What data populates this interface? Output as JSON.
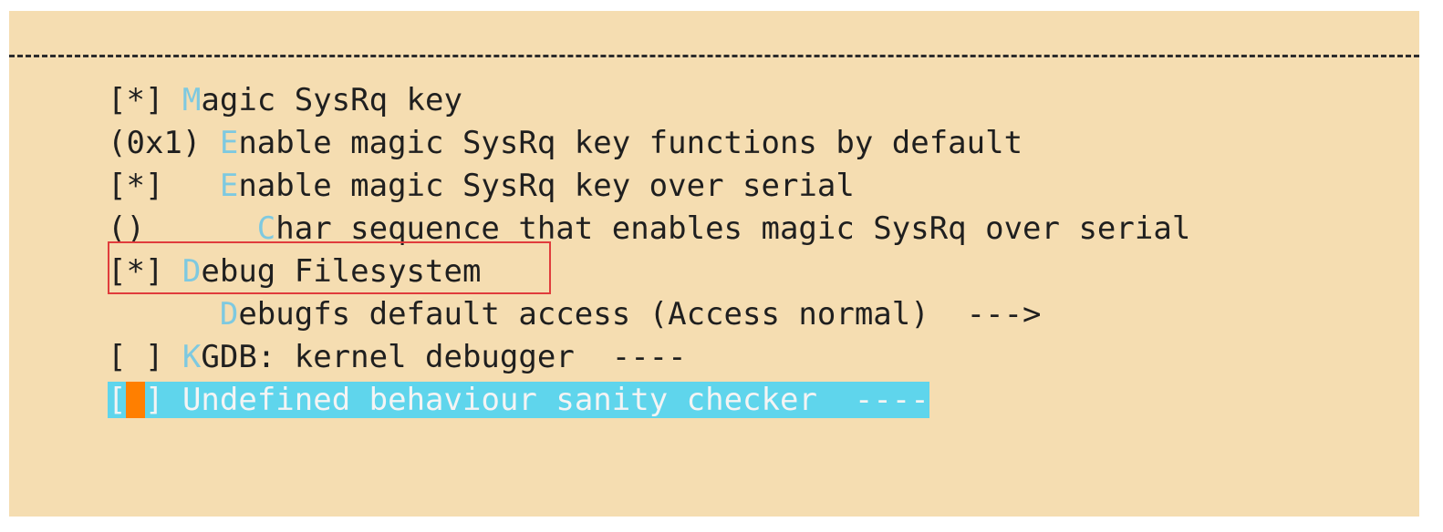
{
  "menu": {
    "items": [
      {
        "mark": "[*]",
        "gap": " ",
        "hotkey": "M",
        "rest_prefix": "",
        "rest": "agic SysRq key"
      },
      {
        "mark": "(0x1)",
        "gap": " ",
        "hotkey": "E",
        "rest": "nable magic SysRq key functions by default"
      },
      {
        "mark": "[*]",
        "gap": "   ",
        "hotkey": "E",
        "rest": "nable magic SysRq key over serial"
      },
      {
        "mark": "()",
        "gap": "      ",
        "hotkey": "C",
        "rest": "har sequence that enables magic SysRq over serial"
      },
      {
        "mark": "[*]",
        "gap": " ",
        "hotkey": "D",
        "rest": "ebug Filesystem"
      },
      {
        "mark": "",
        "gap": "      ",
        "hotkey": "D",
        "rest": "ebugfs default access (Access normal)  --->"
      },
      {
        "mark": "[ ]",
        "gap": " ",
        "hotkey": "K",
        "rest": "GDB: kernel debugger  ----"
      },
      {
        "mark_open": "[",
        "mark_cursor": " ",
        "mark_close": "]",
        "gap": " ",
        "hotkey": "U",
        "rest": "ndefined behaviour sanity checker  ----"
      }
    ]
  },
  "colors": {
    "background": "#f5ddb1",
    "hotkey": "#7ec9e0",
    "selected_row": "#5fd5ec",
    "cursor": "#ff7f00",
    "highlight_box": "#e03c3c"
  }
}
